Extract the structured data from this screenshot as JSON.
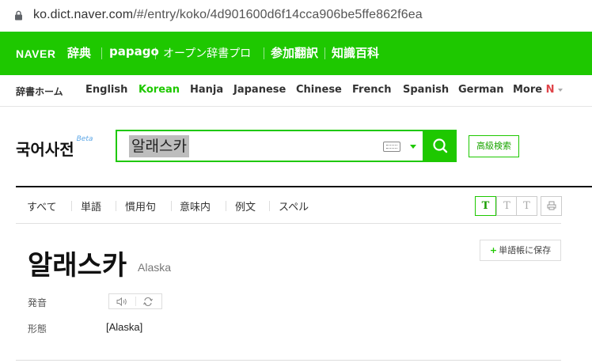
{
  "browser": {
    "url_host": "ko.dict.naver.com",
    "url_path": "/#/entry/koko/4d901600d6f14cca906be5ffe862f6ea"
  },
  "header": {
    "brand": "NAVER",
    "items": [
      "辞典",
      "papago",
      "オープン辞書プロ",
      "参加翻訳",
      "知識百科"
    ]
  },
  "lang_nav": {
    "items": [
      "辞書ホーム",
      "English",
      "Korean",
      "Hanja",
      "Japanese",
      "Chinese",
      "French",
      "Spanish",
      "German",
      "More"
    ],
    "more_badge": "N",
    "active": "Korean"
  },
  "search": {
    "dict_title": "국어사전",
    "beta": "Beta",
    "query": "알래스카",
    "advanced_label": "高級検索"
  },
  "tabs": {
    "items": [
      "すべて",
      "単語",
      "慣用句",
      "意味内",
      "例文",
      "スペル"
    ],
    "font_sizes": [
      "T",
      "T",
      "T"
    ]
  },
  "entry": {
    "word": "알래스카",
    "meaning": "Alaska",
    "save_label": "単語帳に保存",
    "pronunciation_label": "発音",
    "form_label": "形態",
    "form_value": "[Alaska]"
  },
  "colors": {
    "brand_green": "#1ec800",
    "new_badge": "#e0454a"
  },
  "icons": [
    "lock-icon",
    "keyboard-icon",
    "chevron-down-icon",
    "search-icon",
    "print-icon",
    "speaker-icon",
    "repeat-icon"
  ]
}
